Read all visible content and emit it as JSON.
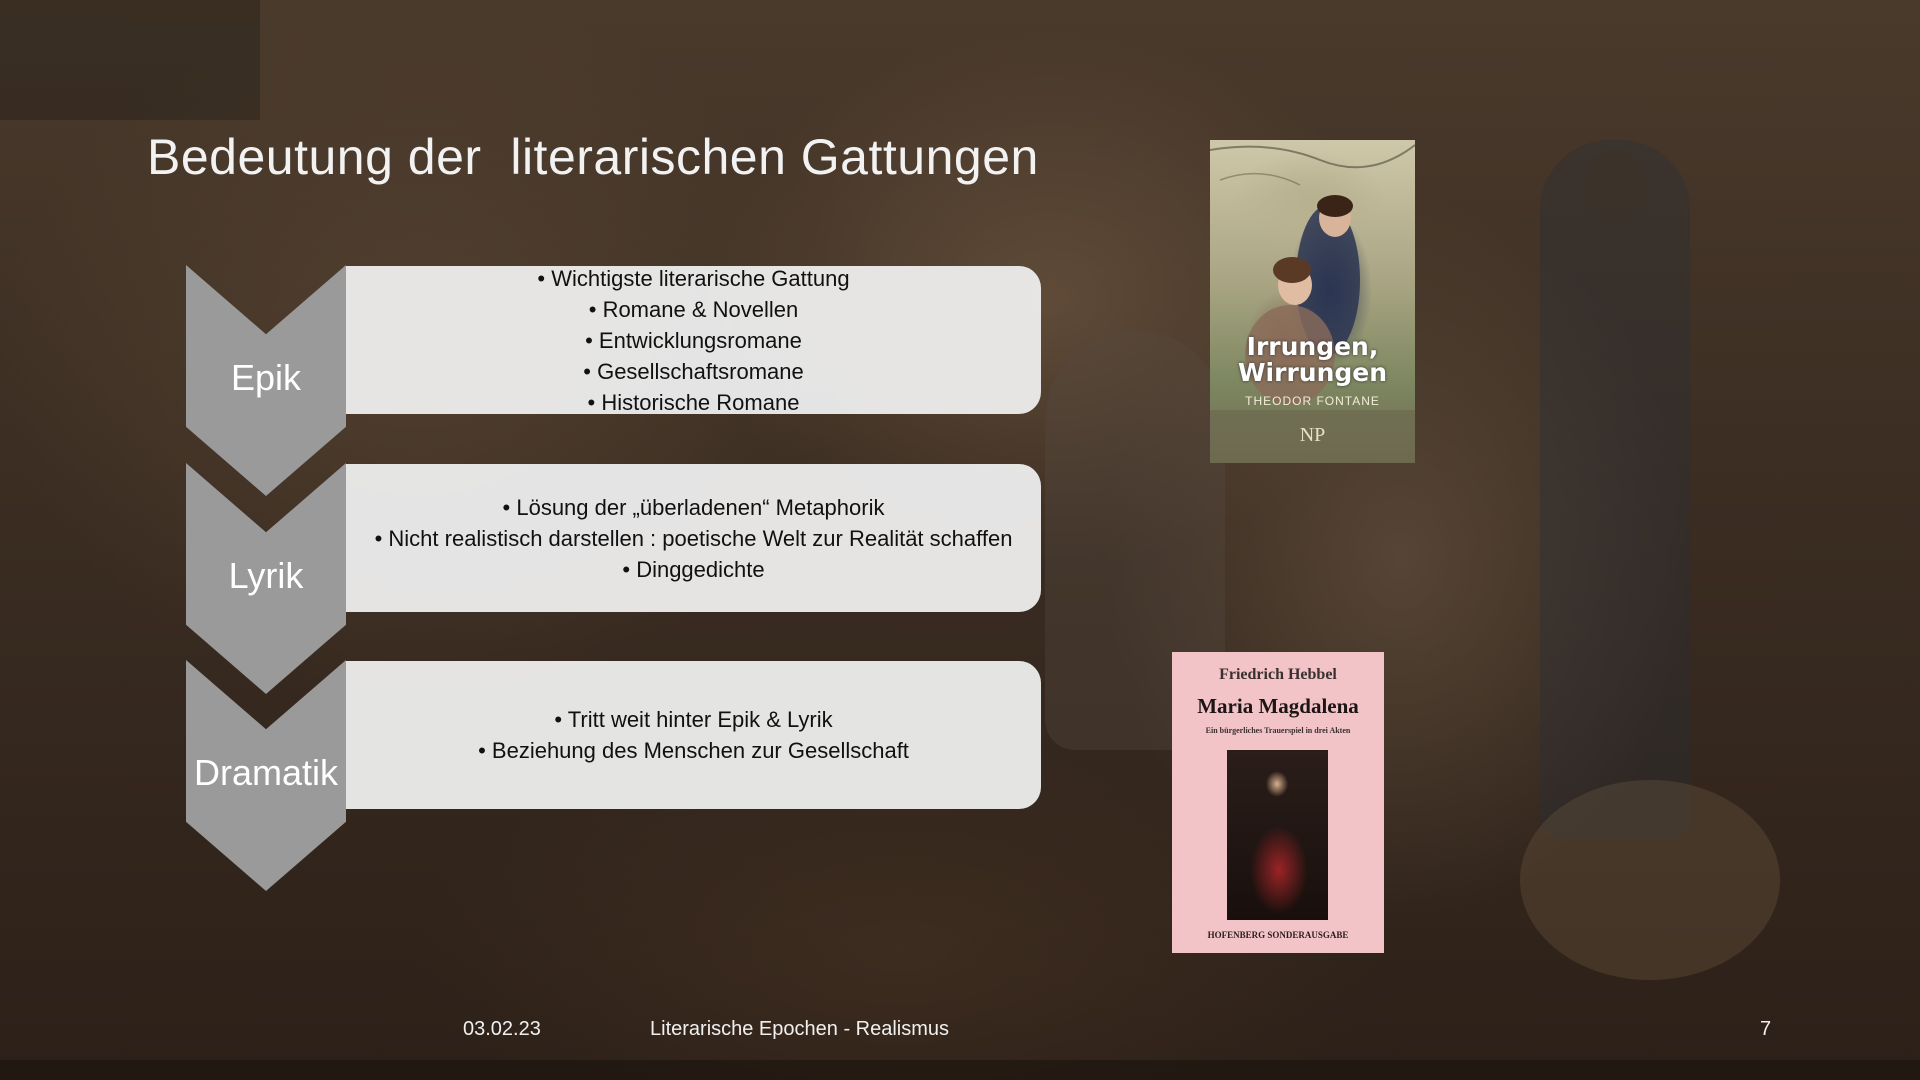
{
  "slide": {
    "title": "Bedeutung der  literarischen Gattungen",
    "genres": [
      {
        "label": "Epik",
        "points": [
          "Wichtigste literarische Gattung",
          "Romane & Novellen",
          "Entwicklungsromane",
          "Gesellschaftsromane",
          "Historische Romane"
        ]
      },
      {
        "label": "Lyrik",
        "points": [
          "Lösung der „überladenen“ Metaphorik",
          "Nicht realistisch darstellen : poetische Welt zur Realität schaffen",
          "Dinggedichte"
        ]
      },
      {
        "label": "Dramatik",
        "points": [
          "Tritt weit hinter Epik & Lyrik",
          "Beziehung des Menschen zur Gesellschaft"
        ]
      }
    ],
    "books": [
      {
        "title": "Irrungen, Wirrungen",
        "author": "THEODOR FONTANE",
        "publisher": "NP"
      },
      {
        "author": "Friedrich Hebbel",
        "title": "Maria Magdalena",
        "subtitle": "Ein bürgerliches Trauerspiel in drei Akten",
        "publisher": "HOFENBERG SONDERAUSGABE"
      }
    ]
  },
  "footer": {
    "date": "03.02.23",
    "center": "Literarische Epochen - Realismus",
    "page": "7"
  },
  "colors": {
    "chevron": "#9a9a9a",
    "card": "#eeeeee",
    "title_text": "#f2f2f2",
    "background": "#3b2d22"
  }
}
